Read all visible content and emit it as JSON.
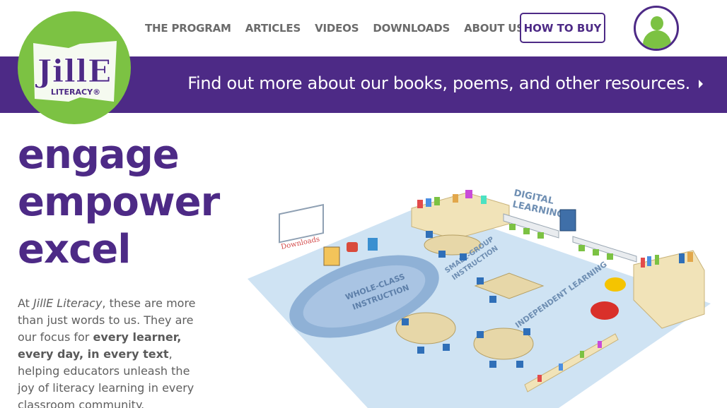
{
  "brand": {
    "logo_text": "JillE",
    "logo_subtext": "LITERACY®",
    "colors": {
      "purple": "#4d2a86",
      "green": "#7cc243"
    }
  },
  "nav": {
    "items": [
      {
        "label": "THE PROGRAM"
      },
      {
        "label": "ARTICLES"
      },
      {
        "label": "VIDEOS"
      },
      {
        "label": "DOWNLOADS"
      },
      {
        "label": "ABOUT US"
      }
    ],
    "buy_label": "HOW TO BUY",
    "account_icon": "user-icon"
  },
  "banner": {
    "text": "Find out more about our books, poems, and other resources."
  },
  "hero": {
    "line1": "engage",
    "line2": "empower",
    "line3": "excel"
  },
  "intro": {
    "p1": "At ",
    "brand": "JillE Literacy",
    "p2": ", these are more than just words to us. They are our focus for ",
    "bold": "every learner, every day, in every text",
    "p3": ", helping educators unleash the joy of literacy learning in every classroom community."
  },
  "illustration": {
    "labels": {
      "digital_1": "DIGITAL",
      "digital_2": "LEARNING",
      "small_1": "SMALL-GROUP",
      "small_2": "INSTRUCTION",
      "whole_1": "WHOLE-CLASS",
      "whole_2": "INSTRUCTION",
      "independent": "INDEPENDENT LEARNING",
      "board": "Downloads"
    }
  }
}
